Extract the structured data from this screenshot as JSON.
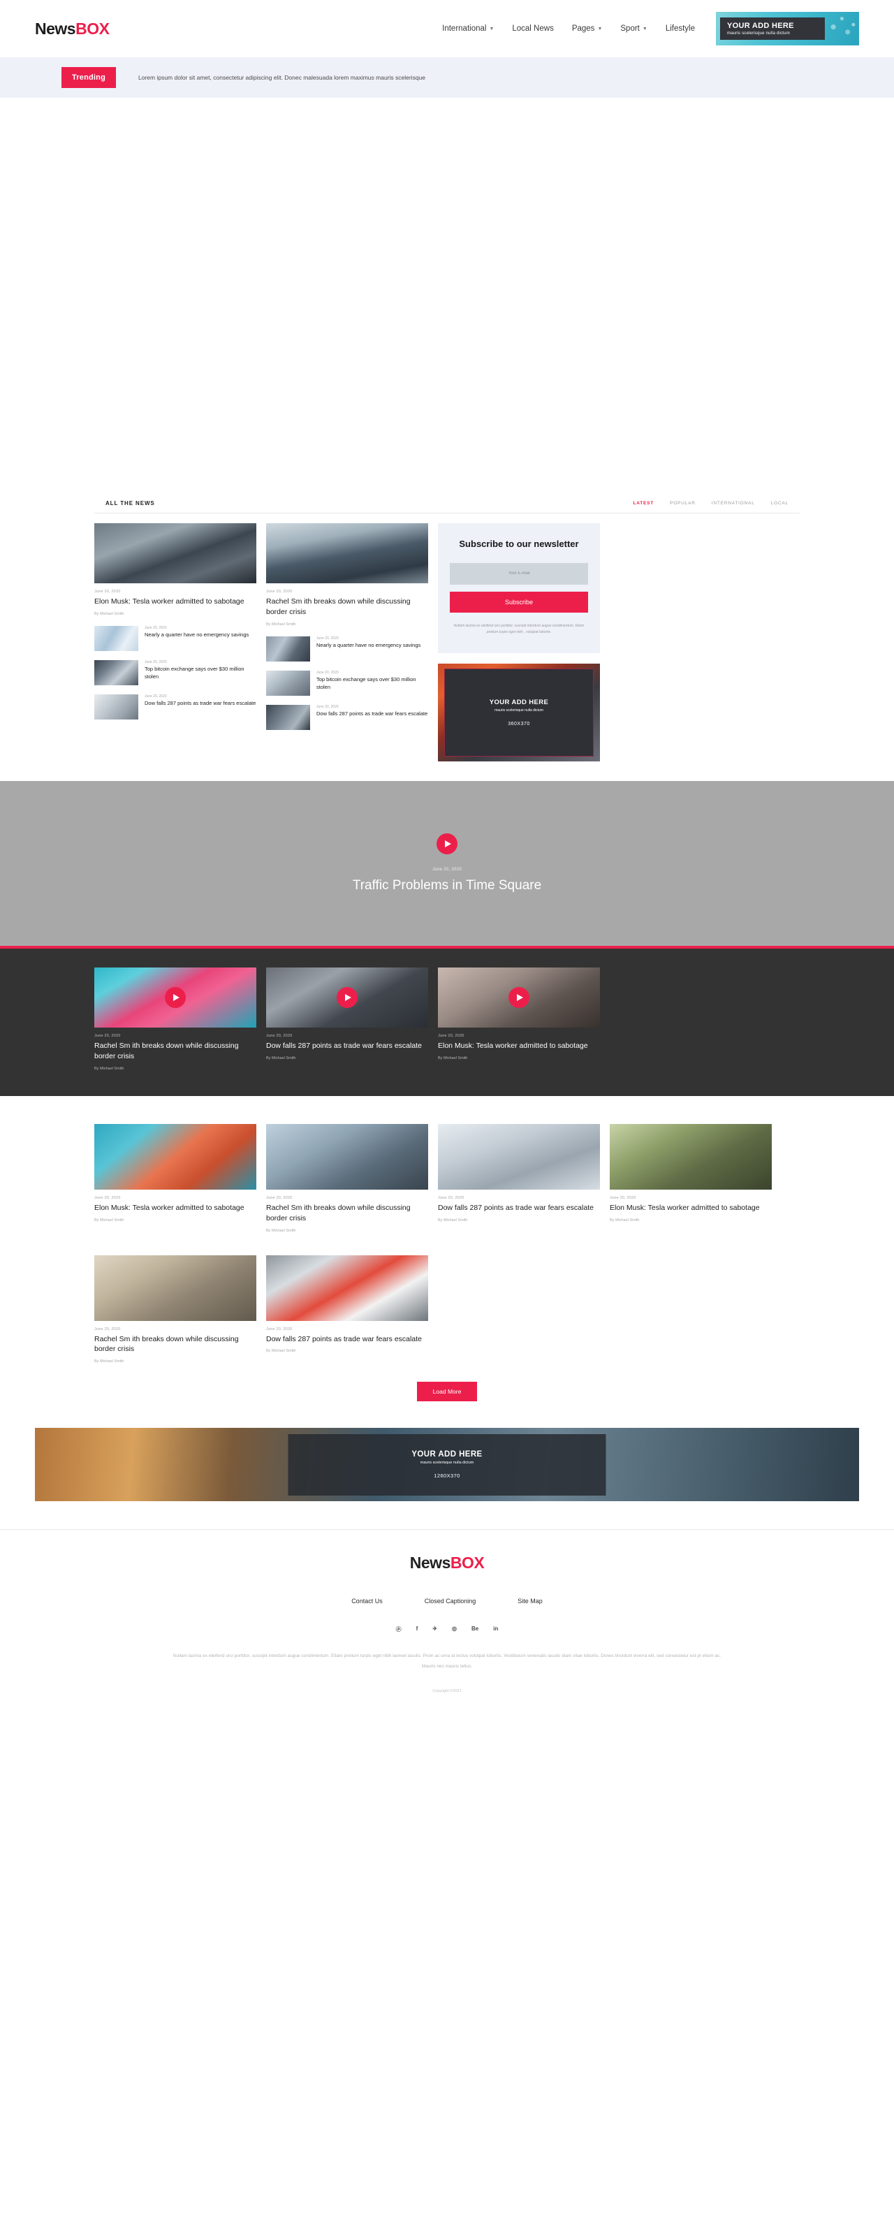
{
  "brand": {
    "part1": "News",
    "part2": "BOX"
  },
  "nav": {
    "items": [
      {
        "label": "International",
        "has_caret": true
      },
      {
        "label": "Local News",
        "has_caret": false
      },
      {
        "label": "Pages",
        "has_caret": true
      },
      {
        "label": "Sport",
        "has_caret": true
      },
      {
        "label": "Lifestyle",
        "has_caret": false
      }
    ]
  },
  "header_ad": {
    "title": "YOUR ADD HERE",
    "subtitle": "mauris scelerisque nulla dictum"
  },
  "trending": {
    "badge": "Trending",
    "text": "Lorem ipsum dolor sit amet, consectetur adipiscing elit. Donec malesuada lorem maximus mauris scelerisque"
  },
  "news_section": {
    "title": "ALL THE NEWS",
    "tabs": [
      {
        "label": "LATEST",
        "active": true
      },
      {
        "label": "POPULAR",
        "active": false
      },
      {
        "label": "INTERNATIONAL",
        "active": false
      },
      {
        "label": "LOCAL",
        "active": false
      }
    ],
    "featured": [
      {
        "date": "June 20, 2020",
        "title": "Elon Musk: Tesla worker admitted to sabotage",
        "author": "By Michael Smith"
      },
      {
        "date": "June 20, 2020",
        "title": "Rachel Sm ith breaks down while discussing border crisis",
        "author": "By Michael Smith"
      }
    ],
    "list_col1": [
      {
        "date": "June 20, 2020",
        "title": "Nearly a quarter have no emergency savings"
      },
      {
        "date": "June 20, 2020",
        "title": "Top bitcoin exchange says over $30 million stolen"
      },
      {
        "date": "June 20, 2020",
        "title": "Dow falls 287 points as trade war fears escalate"
      }
    ],
    "list_col2": [
      {
        "date": "June 20, 2020",
        "title": "Nearly a quarter have no emergency savings"
      },
      {
        "date": "June 20, 2020",
        "title": "Top bitcoin exchange says over $30 million stolen"
      },
      {
        "date": "June 20, 2020",
        "title": "Dow falls 287 points as trade war fears escalate"
      }
    ]
  },
  "newsletter": {
    "title": "Subscribe to our newsletter",
    "email_placeholder": "Your E-mail",
    "email_value": "",
    "button": "Subscribe",
    "note": "Nullam lacinia ex eleifend orci porttitor, suscipit interdum augue condimentum. Etiam pretium turpis eget nibh , volutpat lobortis."
  },
  "sidebar_ad": {
    "title": "YOUR ADD HERE",
    "subtitle": "mauris scelerisque nulla dictum",
    "size": "360X370"
  },
  "video_hero": {
    "date": "June 20, 2020",
    "title": "Traffic Problems in Time Square",
    "play_icon": "play-icon"
  },
  "video_strip": [
    {
      "date": "June 20, 2020",
      "title": "Rachel Sm ith breaks down while discussing border crisis",
      "author": "By Michael Smith"
    },
    {
      "date": "June 20, 2020",
      "title": "Dow falls 287 points as trade war fears escalate",
      "author": "By Michael Smith"
    },
    {
      "date": "June 20, 2020",
      "title": "Elon Musk: Tesla worker admitted to sabotage",
      "author": "By Michael Smith"
    }
  ],
  "bottom_grid": [
    {
      "date": "June 20, 2020",
      "title": "Elon Musk: Tesla worker admitted to sabotage",
      "author": "By Michael Smith"
    },
    {
      "date": "June 20, 2020",
      "title": "Rachel Sm ith breaks down while discussing border crisis",
      "author": "By Michael Smith"
    },
    {
      "date": "June 20, 2020",
      "title": "Dow falls 287 points as trade war fears escalate",
      "author": "By Michael Smith"
    },
    {
      "date": "June 20, 2020",
      "title": "Elon Musk: Tesla worker admitted to sabotage",
      "author": "By Michael Smith"
    },
    {
      "date": "June 20, 2020",
      "title": "Rachel Sm ith breaks down while discussing border crisis",
      "author": "By Michael Smith"
    },
    {
      "date": "June 20, 2020",
      "title": "Dow falls 287 points as trade war fears escalate",
      "author": "By Michael Smith"
    }
  ],
  "load_more": "Load More",
  "bottom_ad": {
    "title": "YOUR ADD HERE",
    "subtitle": "mauris scelerisque nulla dictum",
    "size": "1260X370"
  },
  "footer": {
    "links": [
      {
        "label": "Contact Us"
      },
      {
        "label": "Closed Captioning"
      },
      {
        "label": "Site Map"
      }
    ],
    "socials": [
      {
        "name": "pinterest-icon",
        "glyph": "ⓟ"
      },
      {
        "name": "facebook-icon",
        "glyph": "f"
      },
      {
        "name": "twitter-icon",
        "glyph": "✈"
      },
      {
        "name": "dribbble-icon",
        "glyph": "◎"
      },
      {
        "name": "behance-icon",
        "glyph": "Be"
      },
      {
        "name": "linkedin-icon",
        "glyph": "in"
      }
    ],
    "text": "Nullam lacinia ex eleifend orci porttitor, suscipit interdum augue condimentum. Etiam pretium turpis eget nibh laoreet iaculis. Proin ac urna at lectus volutpat lobortis. Vestibulum venenatis iaculis diam vitae lobortis. Donec tincidunt viverra elit, sed consectetur est pr etium ac. Mauris nec mauris tellus.",
    "copyright": "Copyright ©2021"
  },
  "colors": {
    "accent": "#ec1f4b",
    "trending_bg": "#eef1f8",
    "dark": "#333333"
  }
}
